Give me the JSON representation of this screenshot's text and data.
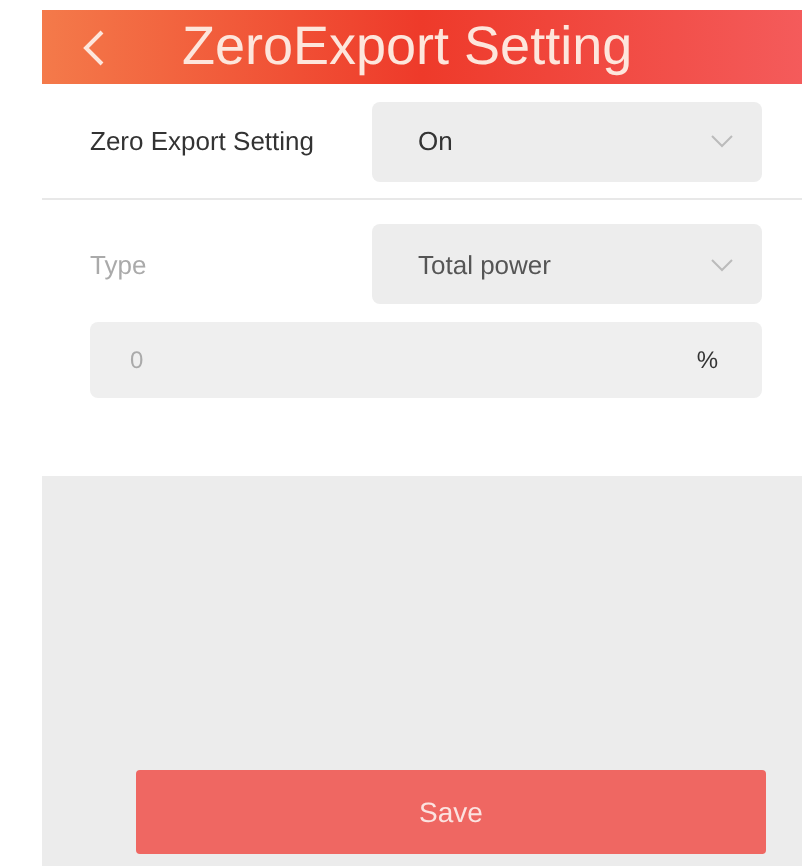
{
  "header": {
    "title": "ZeroExport Setting"
  },
  "fields": [
    {
      "label": "Zero Export Setting",
      "kind": "select",
      "value": "On",
      "disabled": false
    },
    {
      "label": "Type",
      "kind": "select",
      "value": "Total power",
      "disabled": true
    }
  ],
  "percent_input": {
    "placeholder": "0",
    "unit": "%"
  },
  "save_button": "Save"
}
